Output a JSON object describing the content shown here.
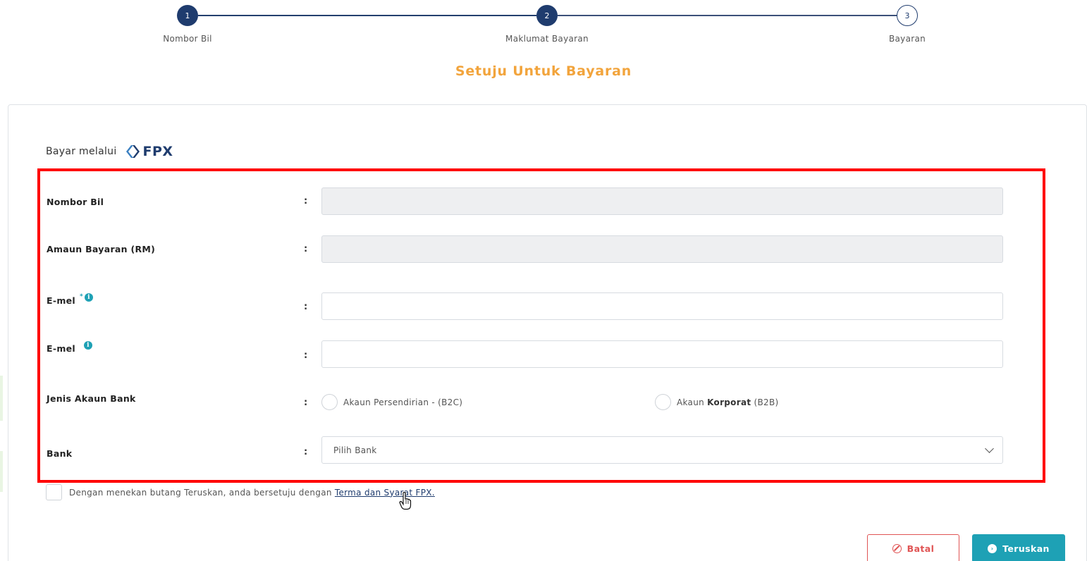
{
  "stepper": {
    "steps": [
      {
        "number": "1",
        "label": "Nombor Bil",
        "state": "done"
      },
      {
        "number": "2",
        "label": "Maklumat Bayaran",
        "state": "done"
      },
      {
        "number": "3",
        "label": "Bayaran",
        "state": "todo"
      }
    ]
  },
  "page_title": "Setuju Untuk Bayaran",
  "pay_via": {
    "label": "Bayar melalui",
    "logo_text": "FPX"
  },
  "form": {
    "bill_number": {
      "label": "Nombor Bil",
      "colon": ":",
      "value": ""
    },
    "amount": {
      "label": "Amaun Bayaran (RM)",
      "colon": ":",
      "value": ""
    },
    "email": {
      "label": "E-mel",
      "required_mark": "*",
      "colon": ":",
      "value": ""
    },
    "email_confirm": {
      "label": "E-mel",
      "colon": ":",
      "value": ""
    },
    "account_type": {
      "label": "Jenis Akaun Bank",
      "colon": ":",
      "options": [
        {
          "label": "Akaun Persendirian - (B2C)"
        },
        {
          "prefix": "Akaun",
          "bold": "Korporat",
          "suffix": "(B2B)"
        }
      ]
    },
    "bank": {
      "label": "Bank",
      "colon": ":",
      "selected": "Pilih Bank"
    }
  },
  "agreement": {
    "text": "Dengan menekan butang Teruskan, anda bersetuju dengan",
    "link": "Terma dan Syarat FPX."
  },
  "buttons": {
    "cancel": "Batal",
    "next": "Teruskan"
  },
  "colors": {
    "primary": "#1f3c6e",
    "accent": "#1ea1b5",
    "title": "#f2a43c",
    "danger": "#e05454",
    "highlight": "#ff0000"
  }
}
